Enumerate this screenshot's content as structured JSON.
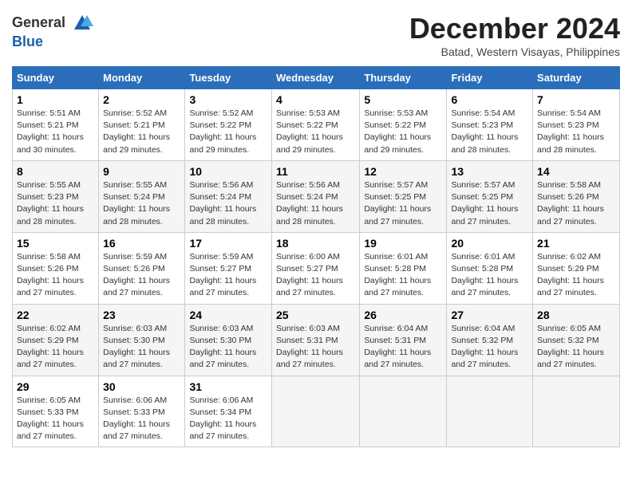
{
  "header": {
    "logo_line1": "General",
    "logo_line2": "Blue",
    "month": "December 2024",
    "location": "Batad, Western Visayas, Philippines"
  },
  "weekdays": [
    "Sunday",
    "Monday",
    "Tuesday",
    "Wednesday",
    "Thursday",
    "Friday",
    "Saturday"
  ],
  "weeks": [
    [
      {
        "day": "1",
        "rise": "Sunrise: 5:51 AM",
        "set": "Sunset: 5:21 PM",
        "daylight": "Daylight: 11 hours and 30 minutes."
      },
      {
        "day": "2",
        "rise": "Sunrise: 5:52 AM",
        "set": "Sunset: 5:21 PM",
        "daylight": "Daylight: 11 hours and 29 minutes."
      },
      {
        "day": "3",
        "rise": "Sunrise: 5:52 AM",
        "set": "Sunset: 5:22 PM",
        "daylight": "Daylight: 11 hours and 29 minutes."
      },
      {
        "day": "4",
        "rise": "Sunrise: 5:53 AM",
        "set": "Sunset: 5:22 PM",
        "daylight": "Daylight: 11 hours and 29 minutes."
      },
      {
        "day": "5",
        "rise": "Sunrise: 5:53 AM",
        "set": "Sunset: 5:22 PM",
        "daylight": "Daylight: 11 hours and 29 minutes."
      },
      {
        "day": "6",
        "rise": "Sunrise: 5:54 AM",
        "set": "Sunset: 5:23 PM",
        "daylight": "Daylight: 11 hours and 28 minutes."
      },
      {
        "day": "7",
        "rise": "Sunrise: 5:54 AM",
        "set": "Sunset: 5:23 PM",
        "daylight": "Daylight: 11 hours and 28 minutes."
      }
    ],
    [
      {
        "day": "8",
        "rise": "Sunrise: 5:55 AM",
        "set": "Sunset: 5:23 PM",
        "daylight": "Daylight: 11 hours and 28 minutes."
      },
      {
        "day": "9",
        "rise": "Sunrise: 5:55 AM",
        "set": "Sunset: 5:24 PM",
        "daylight": "Daylight: 11 hours and 28 minutes."
      },
      {
        "day": "10",
        "rise": "Sunrise: 5:56 AM",
        "set": "Sunset: 5:24 PM",
        "daylight": "Daylight: 11 hours and 28 minutes."
      },
      {
        "day": "11",
        "rise": "Sunrise: 5:56 AM",
        "set": "Sunset: 5:24 PM",
        "daylight": "Daylight: 11 hours and 28 minutes."
      },
      {
        "day": "12",
        "rise": "Sunrise: 5:57 AM",
        "set": "Sunset: 5:25 PM",
        "daylight": "Daylight: 11 hours and 27 minutes."
      },
      {
        "day": "13",
        "rise": "Sunrise: 5:57 AM",
        "set": "Sunset: 5:25 PM",
        "daylight": "Daylight: 11 hours and 27 minutes."
      },
      {
        "day": "14",
        "rise": "Sunrise: 5:58 AM",
        "set": "Sunset: 5:26 PM",
        "daylight": "Daylight: 11 hours and 27 minutes."
      }
    ],
    [
      {
        "day": "15",
        "rise": "Sunrise: 5:58 AM",
        "set": "Sunset: 5:26 PM",
        "daylight": "Daylight: 11 hours and 27 minutes."
      },
      {
        "day": "16",
        "rise": "Sunrise: 5:59 AM",
        "set": "Sunset: 5:26 PM",
        "daylight": "Daylight: 11 hours and 27 minutes."
      },
      {
        "day": "17",
        "rise": "Sunrise: 5:59 AM",
        "set": "Sunset: 5:27 PM",
        "daylight": "Daylight: 11 hours and 27 minutes."
      },
      {
        "day": "18",
        "rise": "Sunrise: 6:00 AM",
        "set": "Sunset: 5:27 PM",
        "daylight": "Daylight: 11 hours and 27 minutes."
      },
      {
        "day": "19",
        "rise": "Sunrise: 6:01 AM",
        "set": "Sunset: 5:28 PM",
        "daylight": "Daylight: 11 hours and 27 minutes."
      },
      {
        "day": "20",
        "rise": "Sunrise: 6:01 AM",
        "set": "Sunset: 5:28 PM",
        "daylight": "Daylight: 11 hours and 27 minutes."
      },
      {
        "day": "21",
        "rise": "Sunrise: 6:02 AM",
        "set": "Sunset: 5:29 PM",
        "daylight": "Daylight: 11 hours and 27 minutes."
      }
    ],
    [
      {
        "day": "22",
        "rise": "Sunrise: 6:02 AM",
        "set": "Sunset: 5:29 PM",
        "daylight": "Daylight: 11 hours and 27 minutes."
      },
      {
        "day": "23",
        "rise": "Sunrise: 6:03 AM",
        "set": "Sunset: 5:30 PM",
        "daylight": "Daylight: 11 hours and 27 minutes."
      },
      {
        "day": "24",
        "rise": "Sunrise: 6:03 AM",
        "set": "Sunset: 5:30 PM",
        "daylight": "Daylight: 11 hours and 27 minutes."
      },
      {
        "day": "25",
        "rise": "Sunrise: 6:03 AM",
        "set": "Sunset: 5:31 PM",
        "daylight": "Daylight: 11 hours and 27 minutes."
      },
      {
        "day": "26",
        "rise": "Sunrise: 6:04 AM",
        "set": "Sunset: 5:31 PM",
        "daylight": "Daylight: 11 hours and 27 minutes."
      },
      {
        "day": "27",
        "rise": "Sunrise: 6:04 AM",
        "set": "Sunset: 5:32 PM",
        "daylight": "Daylight: 11 hours and 27 minutes."
      },
      {
        "day": "28",
        "rise": "Sunrise: 6:05 AM",
        "set": "Sunset: 5:32 PM",
        "daylight": "Daylight: 11 hours and 27 minutes."
      }
    ],
    [
      {
        "day": "29",
        "rise": "Sunrise: 6:05 AM",
        "set": "Sunset: 5:33 PM",
        "daylight": "Daylight: 11 hours and 27 minutes."
      },
      {
        "day": "30",
        "rise": "Sunrise: 6:06 AM",
        "set": "Sunset: 5:33 PM",
        "daylight": "Daylight: 11 hours and 27 minutes."
      },
      {
        "day": "31",
        "rise": "Sunrise: 6:06 AM",
        "set": "Sunset: 5:34 PM",
        "daylight": "Daylight: 11 hours and 27 minutes."
      },
      null,
      null,
      null,
      null
    ]
  ]
}
